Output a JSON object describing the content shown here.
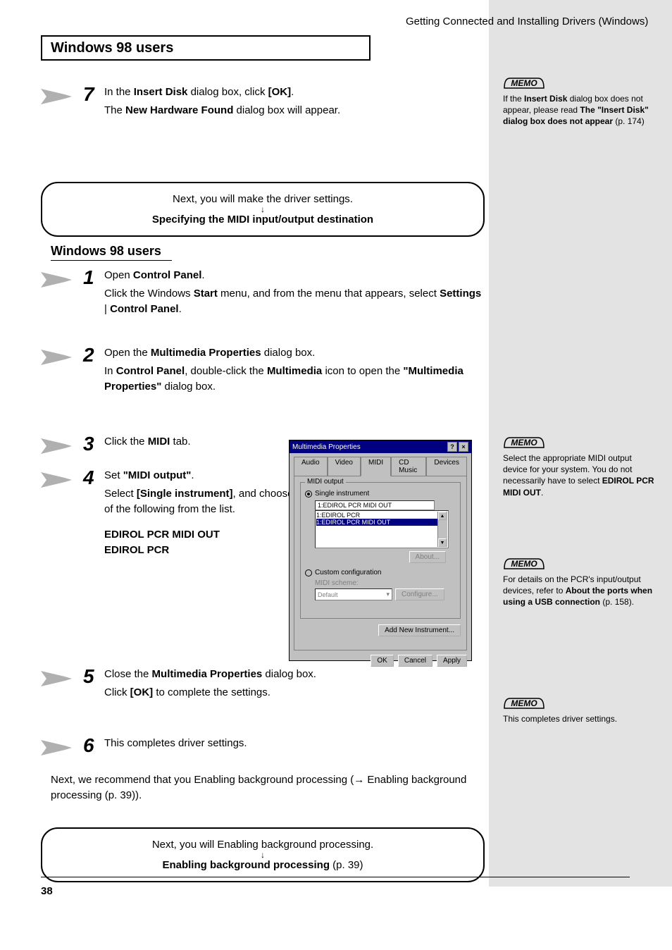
{
  "page": {
    "number": "38",
    "footer_text": "Getting Connected and Installing Drivers (Windows)"
  },
  "title_box": "Windows 98 users",
  "step7": {
    "n": "7",
    "text_a": "In the ",
    "text_b": "Insert Disk",
    "text_c": " dialog box, click ",
    "text_d": "[OK]",
    "text_e": "."
  },
  "indent7": {
    "a": "The ",
    "b": "New Hardware Found",
    "c": " dialog box will appear."
  },
  "callout8": {
    "a": "Next, you will make the driver settings.\n",
    "b": "↓",
    "c": "Specifying the MIDI input/output destination"
  },
  "subheading": "Windows 98 users",
  "s1": {
    "n": "1",
    "a": "Open ",
    "b": "Control Panel",
    "c": "."
  },
  "s1_indent": {
    "a": "Click the Windows ",
    "b": "Start",
    "c": " menu, and from the menu that appears, select ",
    "d": "Settings",
    "e": " | ",
    "f": "Control Panel",
    "g": "."
  },
  "s2": {
    "n": "2",
    "a": "Open the ",
    "b": "Multimedia Properties",
    "c": " dialog box."
  },
  "s2_indent": {
    "a": "In ",
    "b": "Control Panel",
    "c": ", double-click the ",
    "d": "Multimedia",
    "e": " icon to open the ",
    "f": "\"Multimedia Properties\"",
    "g": " dialog box."
  },
  "s3": {
    "n": "3",
    "a": "Click the ",
    "b": "MIDI",
    "c": " tab."
  },
  "s4": {
    "n": "4",
    "a": "Set ",
    "b": "\"MIDI output\"",
    "c": "."
  },
  "s4_indent": {
    "a": "Select ",
    "b": "[Single instrument]",
    "c": ", and choose one of the following from the list."
  },
  "s4_list": {
    "a": "EDIROL PCR MIDI OUT",
    "b": "EDIROL PCR"
  },
  "s5": {
    "n": "5",
    "a": "Close the ",
    "b": "Multimedia Properties",
    "c": " dialog box."
  },
  "s5_indent": {
    "a": "Click ",
    "b": "[OK]",
    "c": " to complete the settings."
  },
  "s6": {
    "n": "6",
    "a": "This completes driver settings."
  },
  "proceed": {
    "a": "Next, we recommend that you Enabling background processing ",
    "b": "(→ Enabling background processing (p. 39))",
    "c": "."
  },
  "callout_bottom": {
    "a": "Next, you will Enabling background processing.\n",
    "b": "↓",
    "c": "Enabling background processing",
    "d": " (p. 39)"
  },
  "memo1": {
    "a": "If the ",
    "b": "Insert Disk",
    "c": " dialog box does not appear, please read ",
    "d": "The \"Insert Disk\" dialog box does not appear",
    "e": " (p. 174)"
  },
  "memo2": {
    "a": "Select the appropriate MIDI output device for your system. You do not necessarily have to select ",
    "b": "EDIROL PCR MIDI OUT",
    "c": "."
  },
  "memo3": {
    "a": "For details on the PCR's input/output devices, refer to ",
    "b": "About the ports when using a USB connection",
    "c": " (p. 158)."
  },
  "memo4": {
    "a": "This completes driver settings."
  },
  "screenshot": {
    "title": "Multimedia Properties",
    "tabs": {
      "audio": "Audio",
      "video": "Video",
      "midi": "MIDI",
      "cd": "CD Music",
      "devices": "Devices"
    },
    "group": "MIDI output",
    "radio1": "Single instrument",
    "field1": "1:EDIROL PCR MIDI OUT",
    "list_a": "1:EDIROL PCR",
    "list_b": "1:EDIROL PCR MIDI OUT",
    "about": "About...",
    "radio2": "Custom configuration",
    "scheme_label": "MIDI scheme:",
    "scheme_val": "Default",
    "configure": "Configure...",
    "add": "Add New Instrument...",
    "ok": "OK",
    "cancel": "Cancel",
    "apply": "Apply"
  }
}
